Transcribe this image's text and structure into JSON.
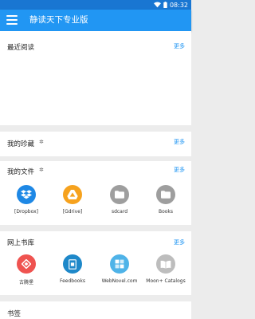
{
  "status": {
    "time": "08:32"
  },
  "app": {
    "title": "静读天下专业版"
  },
  "sections": {
    "recent": {
      "title": "最近阅读",
      "more": "更多"
    },
    "favorites": {
      "title": "我的珍藏",
      "gear": "✲",
      "more": "更多"
    },
    "files": {
      "title": "我的文件",
      "gear": "✲",
      "more": "更多",
      "items": [
        {
          "label": "[Dropbox]",
          "icon": "dropbox-icon",
          "color": "#1e88e5"
        },
        {
          "label": "[Gdrive]",
          "icon": "google-drive-icon",
          "color": "#f6a21e"
        },
        {
          "label": "sdcard",
          "icon": "folder-icon",
          "color": "#9e9e9e"
        },
        {
          "label": "Books",
          "icon": "folder-icon",
          "color": "#9e9e9e"
        }
      ]
    },
    "online": {
      "title": "网上书库",
      "more": "更多",
      "items": [
        {
          "label": "古腾堡",
          "icon": "gutenberg-icon",
          "color": "#ef5350"
        },
        {
          "label": "Feedbooks",
          "icon": "feedbooks-icon",
          "color": "#1e88c9"
        },
        {
          "label": "WebNovel.com",
          "icon": "webnovel-icon",
          "color": "#4fb3e8"
        },
        {
          "label": "Moon+ Catalogs",
          "icon": "moon-catalogs-icon",
          "color": "#bdbdbd"
        }
      ]
    },
    "bookmarks": {
      "title": "书签"
    }
  }
}
